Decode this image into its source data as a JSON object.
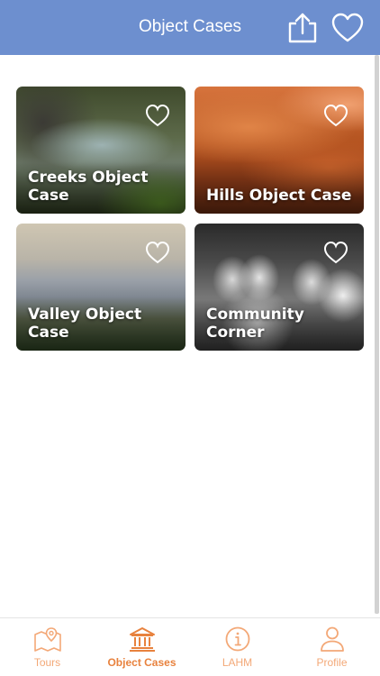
{
  "header": {
    "title": "Object Cases",
    "share_icon": "share-upload-icon",
    "favorite_icon": "heart-outline-icon",
    "background_color": "#6d8fcf"
  },
  "cards": [
    {
      "title": "Creeks Object Case",
      "icon": "heart-outline-icon"
    },
    {
      "title": "Hills Object Case",
      "icon": "heart-outline-icon"
    },
    {
      "title": "Valley Object Case",
      "icon": "heart-outline-icon"
    },
    {
      "title": "Community Corner",
      "icon": "heart-outline-icon"
    }
  ],
  "tabbar": {
    "accent_color": "#e8823e",
    "items": [
      {
        "label": "Tours",
        "icon": "map-pin-icon",
        "active": false
      },
      {
        "label": "Object Cases",
        "icon": "museum-building-icon",
        "active": true
      },
      {
        "label": "LAHM",
        "icon": "info-circle-icon",
        "active": false
      },
      {
        "label": "Profile",
        "icon": "person-icon",
        "active": false
      }
    ]
  }
}
